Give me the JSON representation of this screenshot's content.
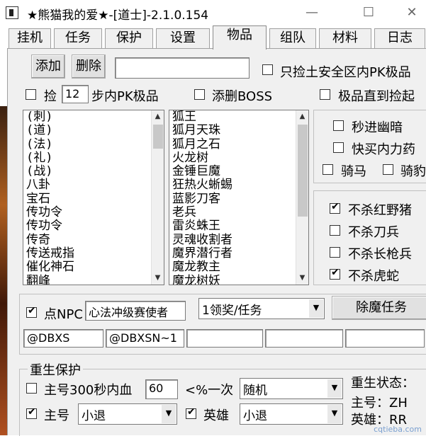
{
  "window": {
    "title": "★熊猫我的爱★-[道士]-2.1.0.154",
    "minimize": "—",
    "maximize": "☐",
    "close": "✕"
  },
  "tabs": [
    "挂机",
    "任务",
    "保护",
    "设置",
    "物品",
    "组队",
    "材料",
    "日志"
  ],
  "active_tab": "物品",
  "toolbar": {
    "add_label": "添加",
    "delete_label": "删除",
    "name_input": "",
    "safe_zone_label": "只捡土安全区内PK极品"
  },
  "pickup": {
    "pick_label_before": "捡",
    "steps_value": "12",
    "pick_label_after": "步内PK极品",
    "add_boss_label": "添删BOSS",
    "direct_pick_label": "极品直到捡起"
  },
  "items_list": [
    "(刺)",
    "(道)",
    "(法)",
    "(礼)",
    "(战)",
    "八卦",
    "宝石",
    "传功令",
    "传功令",
    "传奇",
    "传送戒指",
    "催化神石",
    "翻峰"
  ],
  "monsters_list": [
    "狐王",
    "狐月天珠",
    "狐月之石",
    "火龙树",
    "金锤巨魔",
    "狂热火蜥蜴",
    "蓝影刀客",
    "老兵",
    "雷炎蛛王",
    "灵魂收割者",
    "魔界潜行者",
    "魔龙教主",
    "魔龙树妖"
  ],
  "options": {
    "instant_dark": "秒进幽暗",
    "quick_buy": "快买内力药",
    "ride": "骑马",
    "ride_leopard": "骑豹"
  },
  "no_kill": {
    "red_boar": "不杀红野猪",
    "saber": "不杀刀兵",
    "spear": "不杀长枪兵",
    "tiger_snake": "不杀虎蛇"
  },
  "npc": {
    "label": "点NPC",
    "value": "心法冲级赛使者",
    "reward_combo": "1领奖/任务",
    "demon_task": "除魔任务"
  },
  "scripts": [
    "@DBXS",
    "@DBXSN~1",
    "",
    "",
    ""
  ],
  "rebirth": {
    "group_title": "重生保护",
    "hp_label": "主号300秒内血",
    "hp_value": "60",
    "hp_suffix": "<%一次",
    "mode_combo": "随机",
    "main_label": "主号",
    "main_combo": "小退",
    "hero_label": "英雄",
    "hero_combo": "小退",
    "status_title": "重生状态：",
    "main_status": "主号：ZH",
    "hero_status": "英雄：RR"
  },
  "watermark": "cqtieba.com"
}
